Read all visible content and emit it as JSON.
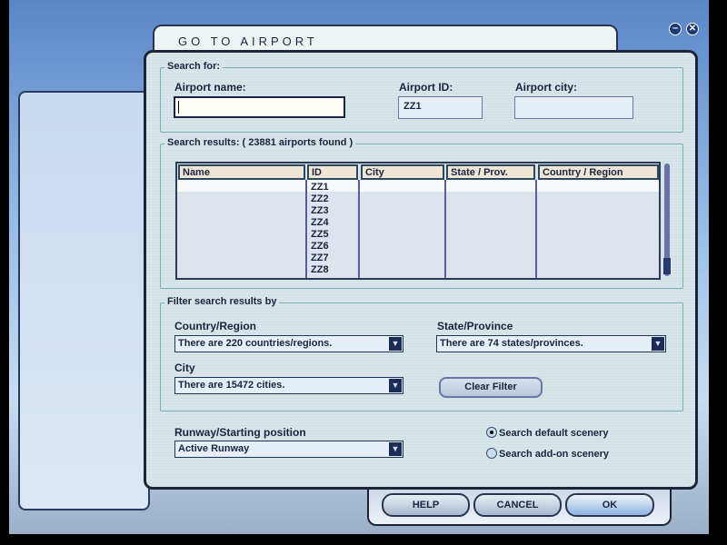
{
  "window": {
    "title": "GO TO AIRPORT"
  },
  "search_for": {
    "legend": "Search for:",
    "name_label": "Airport name:",
    "name_value": "",
    "id_label": "Airport ID:",
    "id_value": "ZZ1",
    "city_label": "Airport city:",
    "city_value": ""
  },
  "results": {
    "legend": "Search results: ( 23881 airports found )",
    "columns": [
      "Name",
      "ID",
      "City",
      "State / Prov.",
      "Country / Region"
    ],
    "ids": [
      "ZZ1",
      "ZZ2",
      "ZZ3",
      "ZZ4",
      "ZZ5",
      "ZZ6",
      "ZZ7",
      "ZZ8"
    ]
  },
  "filter": {
    "legend": "Filter search results by",
    "country_label": "Country/Region",
    "country_value": "There are 220 countries/regions.",
    "state_label": "State/Province",
    "state_value": "There are 74 states/provinces.",
    "city_label": "City",
    "city_value": "There are 15472 cities.",
    "clear_label": "Clear Filter"
  },
  "runway": {
    "label": "Runway/Starting position",
    "value": "Active Runway"
  },
  "scenery": {
    "default_label": "Search default scenery",
    "addon_label": "Search add-on scenery",
    "selected": "default"
  },
  "buttons": {
    "help": "HELP",
    "cancel": "CANCEL",
    "ok": "OK"
  }
}
